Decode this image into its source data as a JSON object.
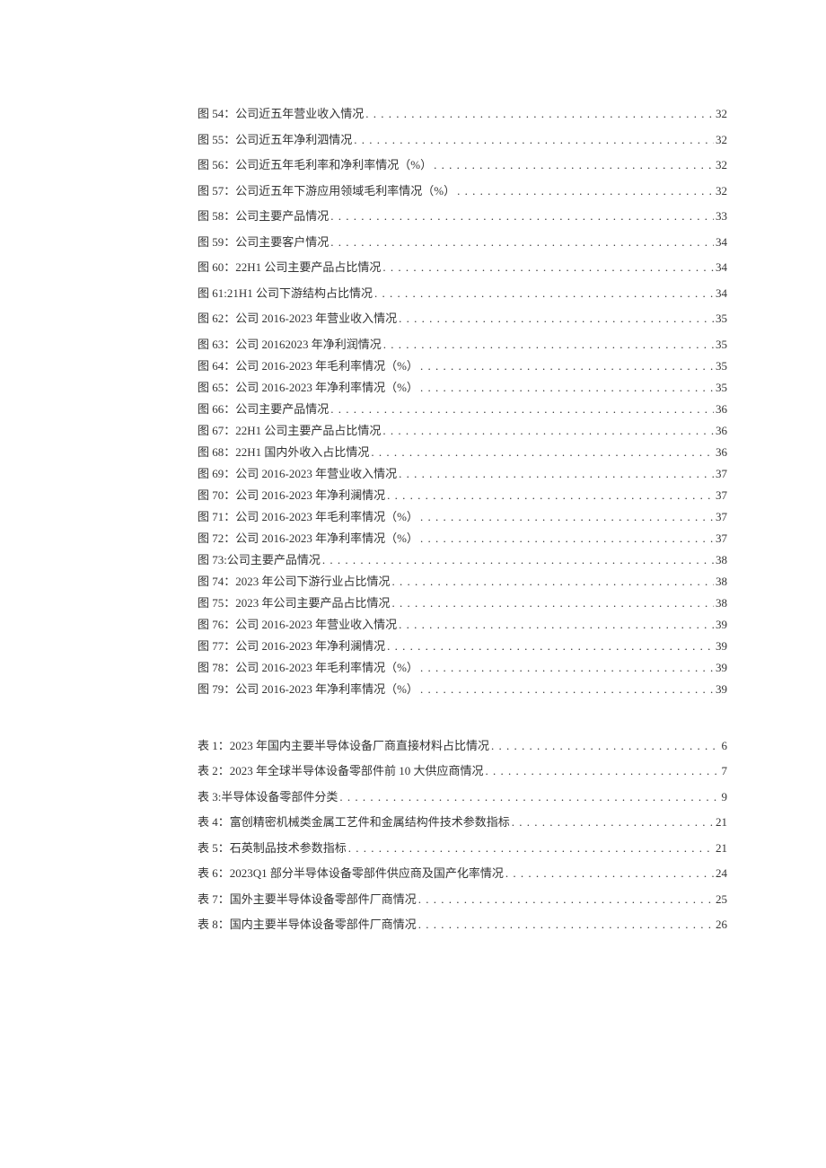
{
  "figures": [
    {
      "label": "图 54：",
      "title": "公司近五年营业收入情况",
      "page": "32"
    },
    {
      "label": "图 55：",
      "title": "公司近五年净利泗情况",
      "page": "32"
    },
    {
      "label": "图 56：",
      "title": "公司近五年毛利率和净利率情况（%）",
      "page": "32"
    },
    {
      "label": "图 57：",
      "title": "公司近五年下游应用领域毛利率情况（%）",
      "page": "32"
    },
    {
      "label": "图 58：",
      "title": "公司主要产品情况",
      "page": "33"
    },
    {
      "label": "图 59：",
      "title": "公司主要客户情况",
      "page": "34"
    },
    {
      "label": "图 60：",
      "title": " 22H1 公司主要产品占比情况",
      "page": "34"
    },
    {
      "label": "图 61:",
      "title": "  21H1 公司下游结构占比情况",
      "page": "34"
    },
    {
      "label": "图 62：",
      "title": "公司 2016-2023 年营业收入情况",
      "page": "35"
    },
    {
      "label": "图 63：",
      "title": "公司 20162023 年净利润情况",
      "page": "35"
    },
    {
      "label": "图 64：",
      "title": "公司 2016-2023 年毛利率情况（%）",
      "page": "35"
    },
    {
      "label": "图 65：",
      "title": "公司 2016-2023 年净利率情况（%）",
      "page": "35"
    },
    {
      "label": "图 66：",
      "title": "公司主要产品情况",
      "page": "36"
    },
    {
      "label": "图 67：",
      "title": "22H1 公司主要产品占比情况 ",
      "page": "36"
    },
    {
      "label": "图 68：",
      "title": "22H1 国内外收入占比情况 ",
      "page": "36"
    },
    {
      "label": "图 69：",
      "title": "公司 2016-2023 年营业收入情况",
      "page": "37"
    },
    {
      "label": "图 70：",
      "title": "公司 2016-2023 年净利澜情况",
      "page": "37"
    },
    {
      "label": "图 71：",
      "title": "公司 2016-2023 年毛利率情况（%）",
      "page": "37"
    },
    {
      "label": "图 72：",
      "title": "公司 2016-2023 年净利率情况（%）",
      "page": "37"
    },
    {
      "label": "图 73:",
      "title": "公司主要产品情况",
      "page": "38"
    },
    {
      "label": "图 74：",
      "title": " 2023 年公司下游行业占比情况",
      "page": "38"
    },
    {
      "label": "图 75：",
      "title": " 2023 年公司主要产品占比情况",
      "page": "38"
    },
    {
      "label": "图 76：",
      "title": "公司 2016-2023 年营业收入情况",
      "page": "39"
    },
    {
      "label": "图 77：",
      "title": "公司 2016-2023 年净利澜情况",
      "page": "39"
    },
    {
      "label": "图 78：",
      "title": "公司 2016-2023 年毛利率情况（%）",
      "page": "39"
    },
    {
      "label": "图 79：",
      "title": "公司 2016-2023 年净利率情况（%）",
      "page": "39"
    }
  ],
  "tables": [
    {
      "label": "表 1：",
      "title": "2023 年国内主要半导体设备厂商直接材料占比情况 ",
      "page": "6"
    },
    {
      "label": "表 2：",
      "title": "2023 年全球半导体设备零部件前 10 大供应商情况",
      "page": "7"
    },
    {
      "label": "表 3:",
      "title": "半导体设备零部件分类 ",
      "page": "9"
    },
    {
      "label": "表 4：",
      "title": "富创精密机械类金属工艺件和金属结构件技术参数指标 ",
      "page": "21"
    },
    {
      "label": "表 5：",
      "title": "石英制品技术参数指标 ",
      "page": "21"
    },
    {
      "label": "表 6：",
      "title": "2023Q1 部分半导体设备零部件供应商及国产化率情况 ",
      "page": "24"
    },
    {
      "label": "表 7：",
      "title": "国外主要半导体设备零部件厂商情况 ",
      "page": "25"
    },
    {
      "label": "表 8：",
      "title": "国内主要半导体设备零部件厂商情况 ",
      "page": "26"
    }
  ]
}
